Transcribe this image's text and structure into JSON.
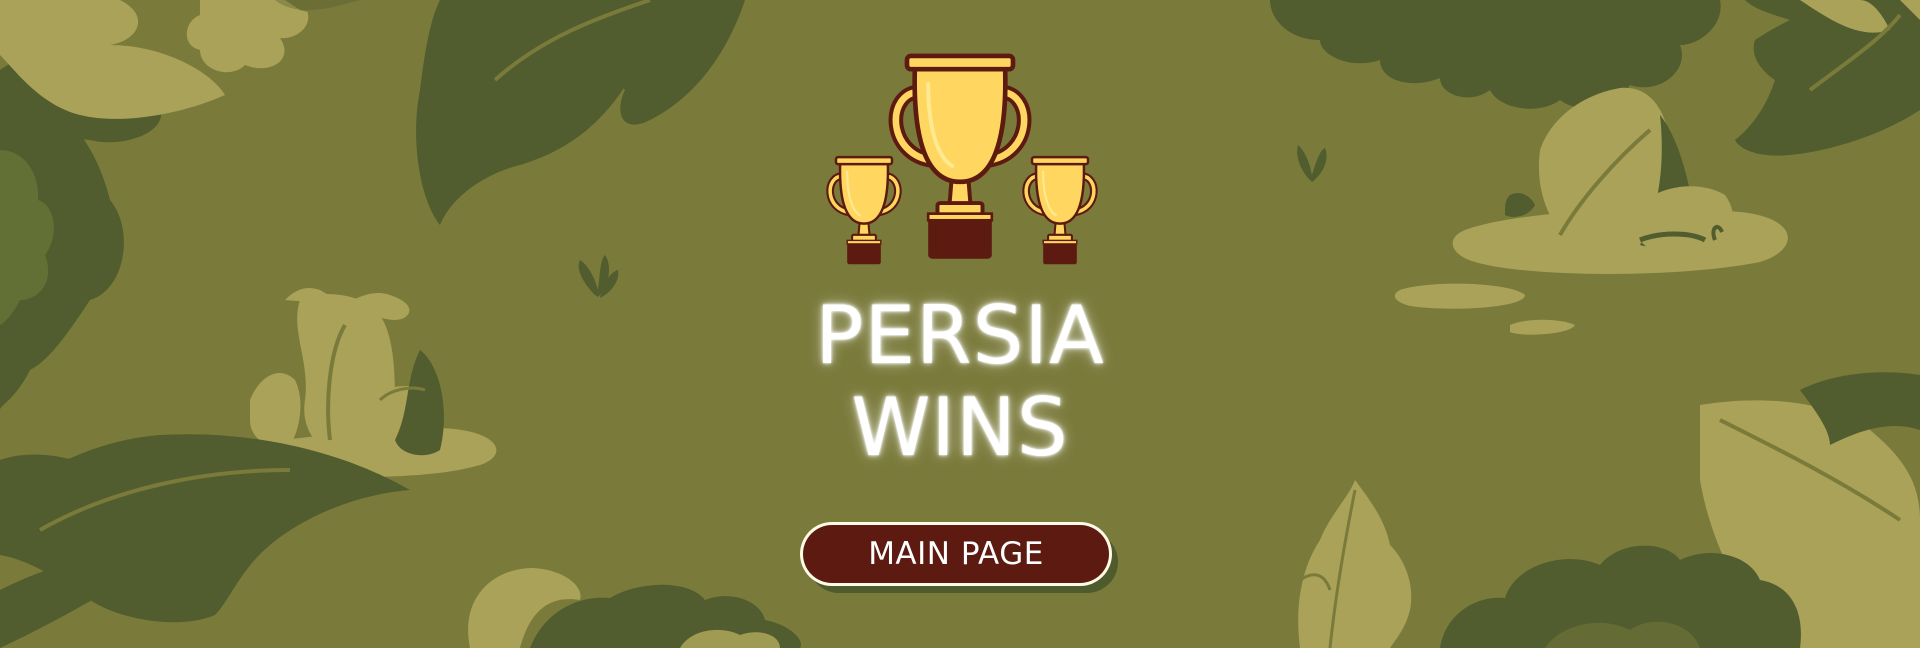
{
  "colors": {
    "background": "#7a7a3b",
    "foliage_dark": "#515d2e",
    "foliage_light": "#a9a258",
    "trophy_gold": "#ffd65f",
    "trophy_outline": "#5c1a10",
    "button_fill": "#5c1a10",
    "button_border": "#fffbe6",
    "title_text": "#ffffff"
  },
  "icons": {
    "trophies": [
      "trophy-small-left-icon",
      "trophy-large-center-icon",
      "trophy-small-right-icon"
    ]
  },
  "result": {
    "line1": "PERSIA",
    "line2": "WINS"
  },
  "buttons": {
    "main_page": "MAIN PAGE"
  }
}
